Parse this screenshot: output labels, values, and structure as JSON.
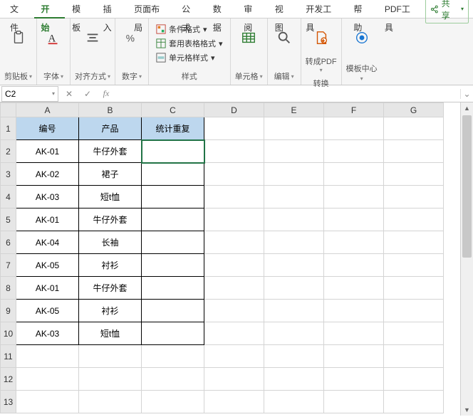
{
  "menu": {
    "tabs": [
      "文件",
      "开始",
      "模板",
      "插入",
      "页面布局",
      "公式",
      "数据",
      "审阅",
      "视图",
      "开发工具",
      "帮助",
      "PDF工具"
    ],
    "active_index": 1,
    "share": "共享"
  },
  "ribbon": {
    "clipboard": "剪贴板",
    "font": "字体",
    "align": "对齐方式",
    "number": "数字",
    "styles_label": "样式",
    "cond_format": "条件格式",
    "table_format": "套用表格格式",
    "cell_format": "单元格样式",
    "cells": "单元格",
    "edit": "编辑",
    "topdf": "转成PDF",
    "convert_label": "转换",
    "template_center": "模板中心"
  },
  "formula": {
    "cell_ref": "C2",
    "value": ""
  },
  "columns": [
    "A",
    "B",
    "C",
    "D",
    "E",
    "F",
    "G"
  ],
  "headers": {
    "a": "编号",
    "b": "产品",
    "c": "统计重复"
  },
  "rows": [
    {
      "a": "AK-01",
      "b": "牛仔外套",
      "c": ""
    },
    {
      "a": "AK-02",
      "b": "裙子",
      "c": ""
    },
    {
      "a": "AK-03",
      "b": "短t恤",
      "c": ""
    },
    {
      "a": "AK-01",
      "b": "牛仔外套",
      "c": ""
    },
    {
      "a": "AK-04",
      "b": "长袖",
      "c": ""
    },
    {
      "a": "AK-05",
      "b": "衬衫",
      "c": ""
    },
    {
      "a": "AK-01",
      "b": "牛仔外套",
      "c": ""
    },
    {
      "a": "AK-05",
      "b": "衬衫",
      "c": ""
    },
    {
      "a": "AK-03",
      "b": "短t恤",
      "c": ""
    }
  ],
  "selected": {
    "r": 2,
    "c": "C"
  }
}
